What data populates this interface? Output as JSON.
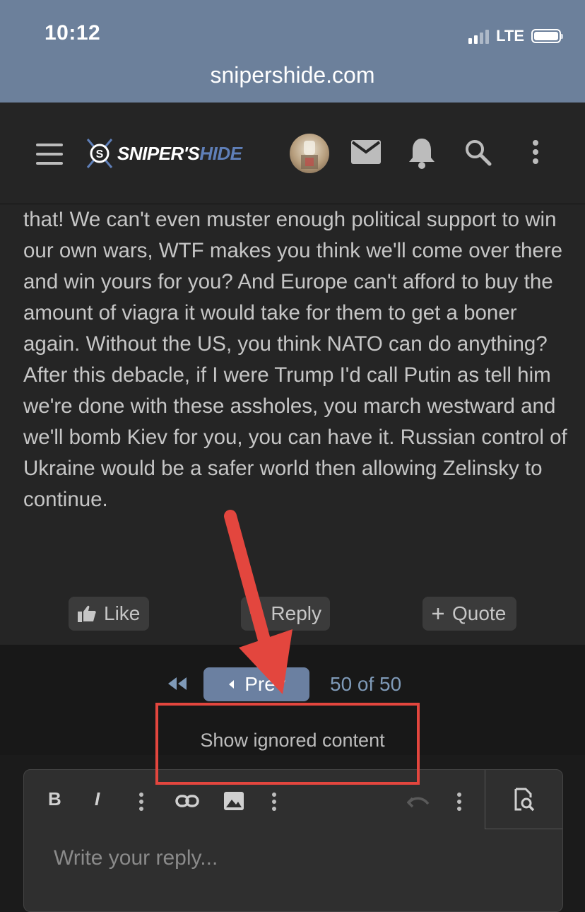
{
  "status_bar": {
    "time": "10:12",
    "network": "LTE",
    "url": "snipershide.com"
  },
  "nav": {
    "logo_text_part1": "SNIPER'S",
    "logo_text_part2": "HIDE",
    "icons": [
      "menu-icon",
      "avatar",
      "mail-icon",
      "bell-icon",
      "search-icon",
      "more-vertical-icon"
    ]
  },
  "post": {
    "body": "that! We can't even muster enough political support to win our own wars, WTF makes you think we'll come over there and win yours for you? And Europe can't afford to buy the amount of viagra it would take for them to get a boner again. Without the US, you think NATO can do anything? After this debacle, if I were Trump I'd call Putin as tell him we're done with these assholes, you march westward and we'll bomb Kiev for you, you can have it. Russian control of Ukraine would be a safer world then allowing Zelinsky to continue."
  },
  "actions": {
    "like": "Like",
    "reply": "Reply",
    "quote": "Quote"
  },
  "pagination": {
    "prev": "Prev",
    "count": "50 of 50"
  },
  "show_ignored": "Show ignored content",
  "editor": {
    "placeholder": "Write your reply...",
    "bold": "B",
    "italic": "I"
  },
  "colors": {
    "status_bar_bg": "#6c809b",
    "nav_bg": "#252525",
    "accent": "#6b80a1",
    "annotation": "#e3463e"
  }
}
